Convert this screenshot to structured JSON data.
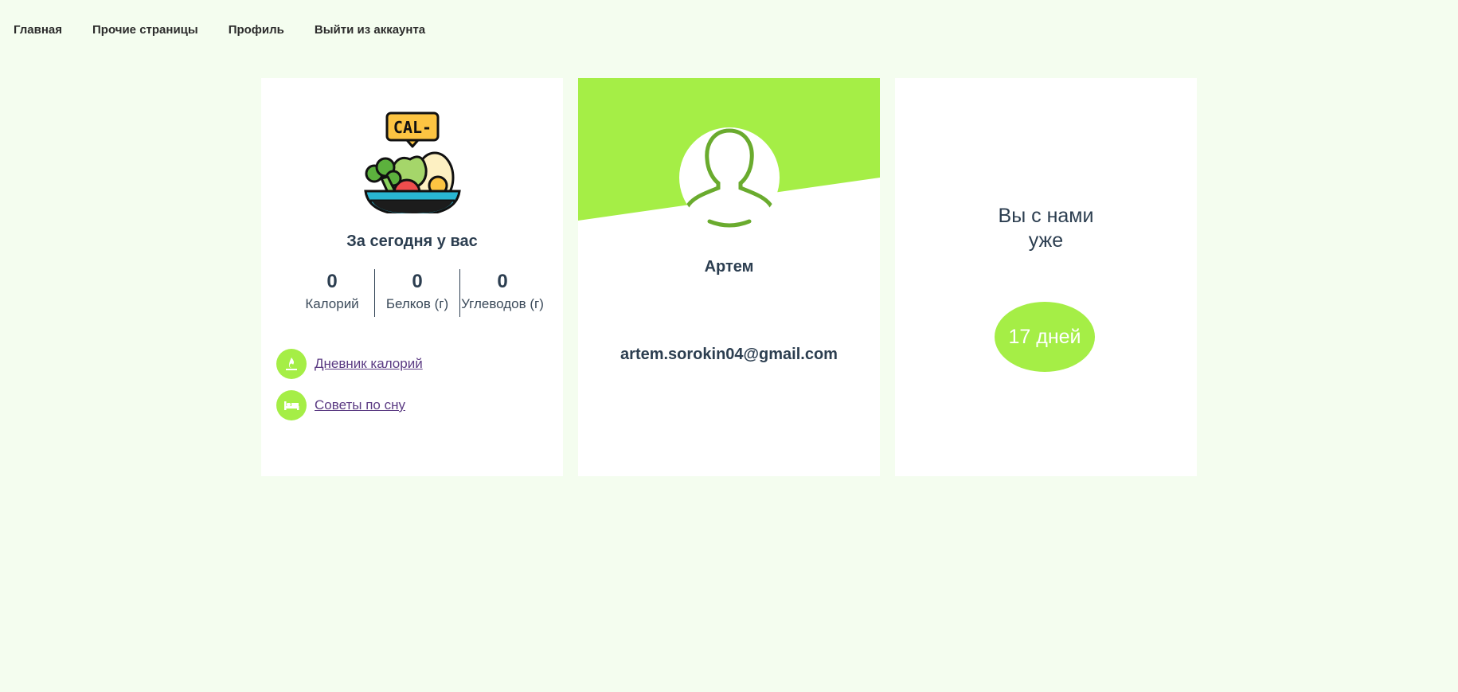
{
  "nav": {
    "items": [
      {
        "label": "Главная"
      },
      {
        "label": "Прочие страницы"
      },
      {
        "label": "Профиль"
      },
      {
        "label": "Выйти из аккаунта"
      }
    ]
  },
  "today_card": {
    "logo_text": "CAL-",
    "title": "За сегодня у вас",
    "stats": [
      {
        "value": "0",
        "label": "Калорий"
      },
      {
        "value": "0",
        "label": "Белков (г)"
      },
      {
        "value": "0",
        "label": "Углеводов (г)"
      }
    ],
    "links": [
      {
        "label": "Дневник калорий",
        "icon": "flame-icon"
      },
      {
        "label": "Советы по сну",
        "icon": "bed-icon"
      }
    ]
  },
  "profile_card": {
    "name": "Артем",
    "email": "artem.sorokin04@gmail.com"
  },
  "membership_card": {
    "line1": "Вы с нами",
    "line2": "уже",
    "days": "17 дней"
  },
  "colors": {
    "accent": "#a5ee46",
    "background": "#f4fdef",
    "text": "#2c3e50",
    "link": "#5b3b83",
    "avatar_outline": "#6aab2e"
  }
}
